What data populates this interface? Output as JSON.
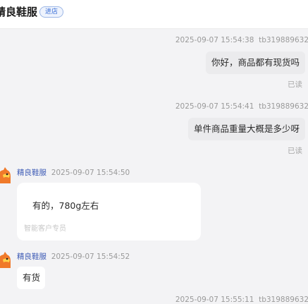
{
  "header": {
    "shop_name": "精良鞋服",
    "enter_shop_label": "进店"
  },
  "messages": [
    {
      "direction": "outgoing",
      "timestamp": "2025-09-07 15:54:38",
      "user": "tb319889632",
      "text": "你好，商品都有现货吗",
      "status": "已读"
    },
    {
      "direction": "outgoing",
      "timestamp": "2025-09-07 15:54:41",
      "user": "tb319889632",
      "text": "单件商品重量大概是多少呀",
      "status": "已读"
    },
    {
      "direction": "incoming",
      "sender": "精良鞋服",
      "timestamp": "2025-09-07 15:54:50",
      "text": "有的，780g左右",
      "sub_note": "智能客户专员"
    },
    {
      "direction": "incoming",
      "sender": "精良鞋服",
      "timestamp": "2025-09-07 15:54:52",
      "text": "有货"
    },
    {
      "direction": "outgoing",
      "timestamp": "2025-09-07 15:55:11",
      "user": "tb319889632"
    }
  ],
  "colors": {
    "background": "#f3f3f5",
    "outgoing_bubble": "#ebebed",
    "incoming_bubble": "#ffffff",
    "sender_name": "#3c5ab5",
    "enter_badge": "#3b6fd6",
    "avatar": "#f07a2a"
  },
  "icons": {
    "avatar": "shop-mascot-avatar-icon"
  }
}
